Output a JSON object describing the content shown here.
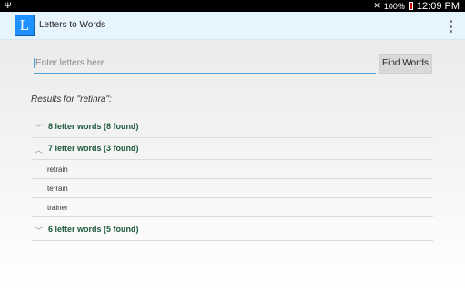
{
  "statusbar": {
    "battery_pct": "100%",
    "time": "12:09 PM",
    "icons": [
      "usb-icon",
      "mute-icon",
      "battery-icon"
    ]
  },
  "actionbar": {
    "logo_letter": "L",
    "title": "Letters to Words",
    "menu_icon": "overflow-menu-icon"
  },
  "search": {
    "placeholder": "Enter letters here",
    "value": ""
  },
  "find_button": "Find Words",
  "results_label": "Results for \"retinra\":",
  "groups": [
    {
      "label": "8 letter words (8 found)",
      "expanded": false
    },
    {
      "label": "7 letter words (3 found)",
      "expanded": true,
      "words": [
        "retrain",
        "terrain",
        "trainer"
      ]
    },
    {
      "label": "6 letter words (5 found)",
      "expanded": false
    }
  ],
  "colors": {
    "accent": "#4aa5d6",
    "group_text": "#1e5a3c",
    "actionbar_bg": "#e6f4fd",
    "logo_bg": "#1e90ff"
  }
}
